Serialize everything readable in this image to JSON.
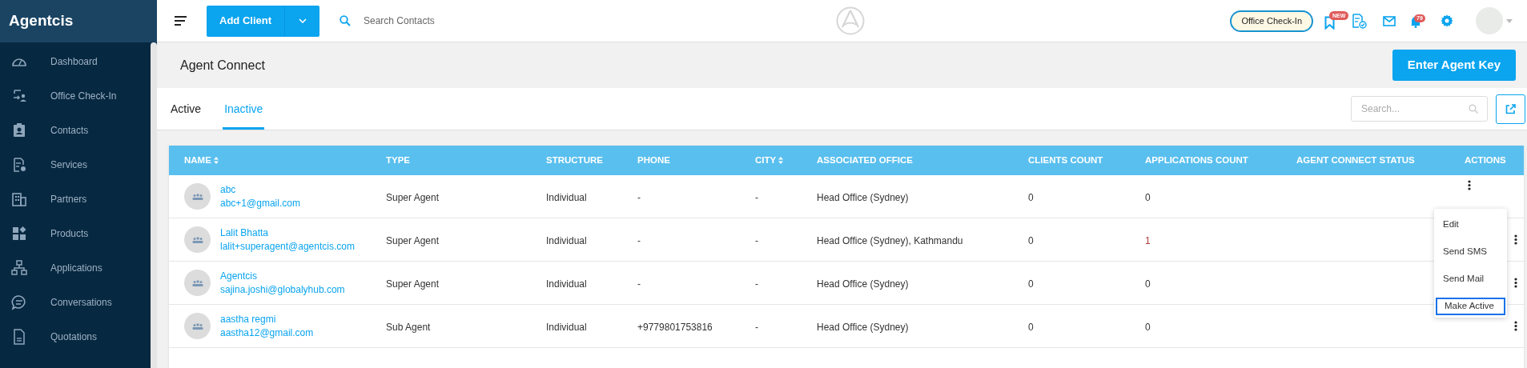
{
  "sidebar": {
    "brand": "Agentcis",
    "items": [
      {
        "label": "Dashboard"
      },
      {
        "label": "Office Check-In"
      },
      {
        "label": "Contacts"
      },
      {
        "label": "Services"
      },
      {
        "label": "Partners"
      },
      {
        "label": "Products"
      },
      {
        "label": "Applications"
      },
      {
        "label": "Conversations"
      },
      {
        "label": "Quotations"
      }
    ]
  },
  "topbar": {
    "add_button": "Add Client",
    "search": {
      "placeholder": "Search Contacts"
    },
    "checkin_button": "Office Check-In",
    "new_badge": "NEW",
    "notification_count": "79"
  },
  "page": {
    "title": "Agent Connect",
    "primary_button": "Enter Agent Key"
  },
  "tabs": [
    {
      "label": "Active",
      "selected": false
    },
    {
      "label": "Inactive",
      "selected": true
    }
  ],
  "table_search": {
    "placeholder": "Search..."
  },
  "table": {
    "columns": [
      {
        "label": "NAME",
        "sortable": true
      },
      {
        "label": "TYPE",
        "sortable": false
      },
      {
        "label": "STRUCTURE",
        "sortable": false
      },
      {
        "label": "PHONE",
        "sortable": false
      },
      {
        "label": "CITY",
        "sortable": true
      },
      {
        "label": "ASSOCIATED OFFICE",
        "sortable": false
      },
      {
        "label": "CLIENTS COUNT",
        "sortable": false
      },
      {
        "label": "APPLICATIONS COUNT",
        "sortable": false
      },
      {
        "label": "AGENT CONNECT STATUS",
        "sortable": false
      },
      {
        "label": "ACTIONS",
        "sortable": false
      }
    ],
    "rows": [
      {
        "name": "abc",
        "email": "abc+1@gmail.com",
        "type": "Super Agent",
        "structure": "Individual",
        "phone": "-",
        "city": "-",
        "office": "Head Office (Sydney)",
        "clients": "0",
        "applications": "0",
        "applications_linked": false,
        "menu_open": true
      },
      {
        "name": "Lalit Bhatta",
        "email": "lalit+superagent@agentcis.com",
        "type": "Super Agent",
        "structure": "Individual",
        "phone": "-",
        "city": "-",
        "office": "Head Office (Sydney), Kathmandu",
        "clients": "0",
        "applications": "1",
        "applications_linked": true,
        "menu_open": false
      },
      {
        "name": "Agentcis",
        "email": "sajina.joshi@globalyhub.com",
        "type": "Super Agent",
        "structure": "Individual",
        "phone": "-",
        "city": "-",
        "office": "Head Office (Sydney)",
        "clients": "0",
        "applications": "0",
        "applications_linked": false,
        "menu_open": false
      },
      {
        "name": "aastha regmi",
        "email": "aastha12@gmail.com",
        "type": "Sub Agent",
        "structure": "Individual",
        "phone": "+9779801753816",
        "city": "-",
        "office": "Head Office (Sydney)",
        "clients": "0",
        "applications": "0",
        "applications_linked": false,
        "menu_open": false
      }
    ]
  },
  "action_menu": {
    "items": [
      {
        "label": "Edit",
        "selected": false
      },
      {
        "label": "Send SMS",
        "selected": false
      },
      {
        "label": "Send Mail",
        "selected": false
      },
      {
        "label": "Make Active",
        "selected": true
      }
    ]
  }
}
